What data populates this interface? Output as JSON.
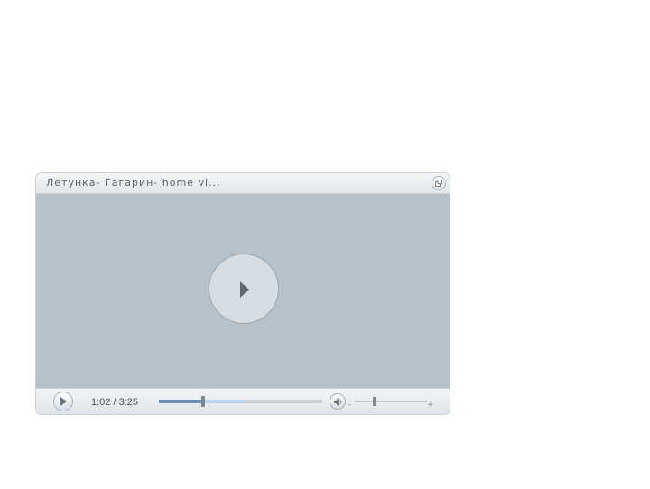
{
  "player": {
    "title": "Летунка- Гагарин- home vi...",
    "time_display": "1:02 / 3:25",
    "progress": {
      "played_fraction": 0.27,
      "buffered_fraction": 0.53
    },
    "volume": {
      "level_fraction": 0.27,
      "minus_label": "–",
      "plus_label": "+"
    },
    "icons": {
      "popout": "popout-icon",
      "big_play": "play-icon",
      "small_play": "play-icon",
      "volume": "speaker-icon"
    },
    "colors": {
      "video_bg": "#b7c1ca",
      "played": "#6d94c0",
      "buffered": "#b9d4ec"
    }
  }
}
